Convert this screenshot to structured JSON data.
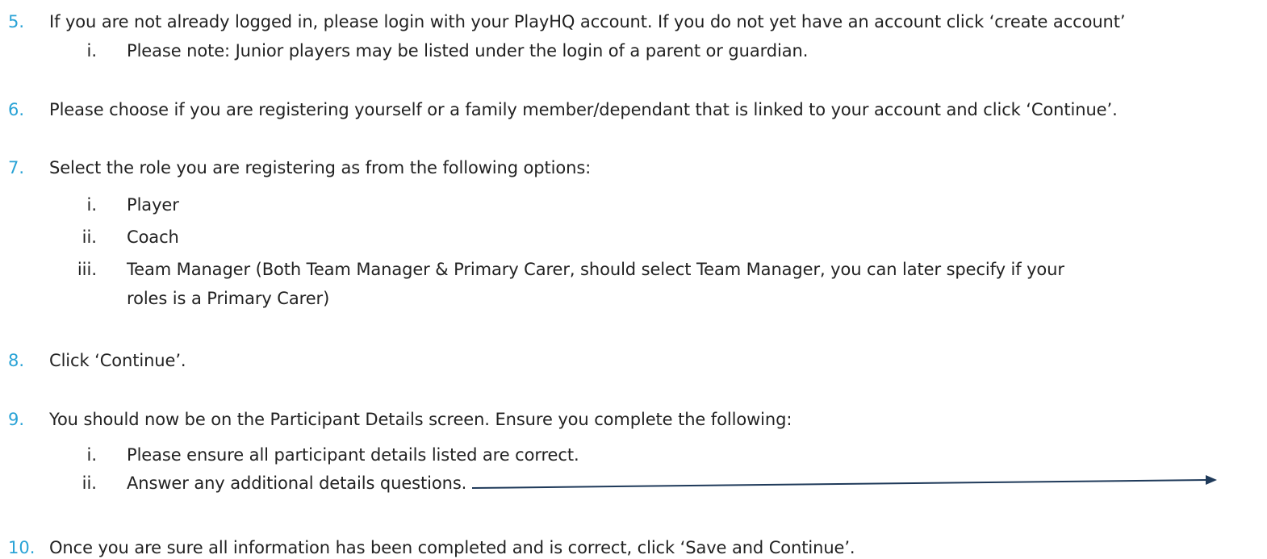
{
  "steps": [
    {
      "num": "5.",
      "text": "If you are not already logged in, please login with your PlayHQ account. If you do not yet have an account click ‘create account’",
      "sub": [
        {
          "num": "i.",
          "text": "Please note: Junior players may be listed under the login of a parent or guardian."
        }
      ]
    },
    {
      "num": "6.",
      "text": "Please choose if you are registering yourself or a family member/dependant that is linked to your account and click ‘Continue’.",
      "sub": []
    },
    {
      "num": "7.",
      "text": "Select the role you are registering as from the following options:",
      "sub": [
        {
          "num": "i.",
          "text": "Player"
        },
        {
          "num": "ii.",
          "text": "Coach"
        },
        {
          "num": "iii.",
          "text": "Team Manager (Both Team Manager & Primary Carer, should select Team Manager, you can later specify if your",
          "cont": "roles is a Primary Carer)"
        }
      ]
    },
    {
      "num": "8.",
      "text": "Click ‘Continue’.",
      "sub": []
    },
    {
      "num": "9.",
      "text": "You should now be on the Participant Details screen. Ensure you complete the following:",
      "sub": [
        {
          "num": "i.",
          "text": "Please ensure all participant details listed are correct."
        },
        {
          "num": "ii.",
          "text": "Answer any additional details questions."
        }
      ]
    },
    {
      "num": "10.",
      "text": "Once you are sure all information has been completed and is correct, click ‘Save and Continue’.",
      "sub": []
    }
  ],
  "colors": {
    "step_number": "#2aa3d6",
    "arrow": "#1f3a5a"
  }
}
